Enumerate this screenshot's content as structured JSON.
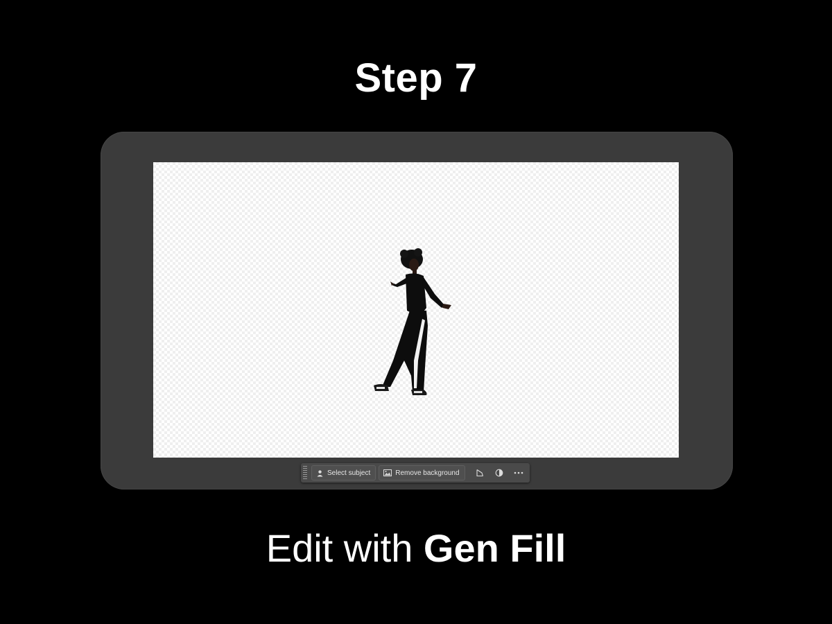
{
  "header": {
    "title": "Step 7"
  },
  "canvas": {
    "background": "transparent-checkerboard",
    "subject": "person-cutout"
  },
  "toolbar": {
    "select_subject_label": "Select subject",
    "select_subject_icon": "person-select-icon",
    "remove_background_label": "Remove background",
    "remove_background_icon": "image-icon",
    "transform_icon": "transform-icon",
    "adjustment_icon": "adjustment-icon",
    "more_icon": "more-options-icon"
  },
  "caption": {
    "prefix": "Edit with",
    "emphasis": "Gen Fill"
  },
  "colors": {
    "background": "#000000",
    "frame": "#3b3b3b",
    "toolbar": "#4a4a4a",
    "text": "#ffffff"
  }
}
